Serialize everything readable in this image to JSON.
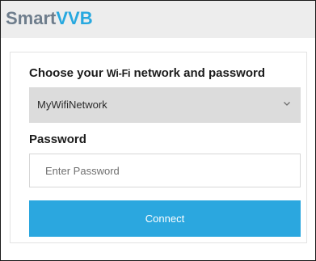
{
  "brand": {
    "name_part1": "Smart",
    "name_part2": "VVB",
    "color_part1": "#6e7d8c",
    "color_part2": "#27a8df"
  },
  "form": {
    "heading_prefix": "Choose your ",
    "heading_wifi": "Wi-Fi",
    "heading_suffix": " network and password",
    "network_select": {
      "value": "MyWifiNetwork",
      "icon": "chevron-down-icon"
    },
    "password_label": "Password",
    "password_input": {
      "placeholder": "Enter Password",
      "value": ""
    },
    "connect_button_label": "Connect",
    "accent_color": "#2ba7df"
  }
}
